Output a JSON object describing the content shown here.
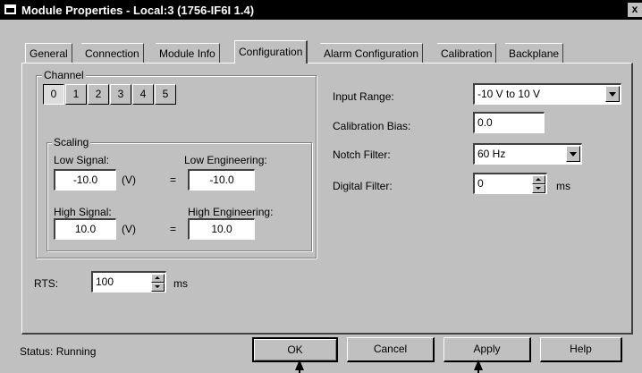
{
  "window": {
    "title": "Module Properties - Local:3 (1756-IF6I 1.4)",
    "close_glyph": "x"
  },
  "tabs": [
    {
      "label": "General"
    },
    {
      "label": "Connection"
    },
    {
      "label": "Module Info"
    },
    {
      "label": "Configuration",
      "active": true
    },
    {
      "label": "Alarm Configuration"
    },
    {
      "label": "Calibration"
    },
    {
      "label": "Backplane"
    }
  ],
  "channel": {
    "group_label": "Channel",
    "buttons": [
      "0",
      "1",
      "2",
      "3",
      "4",
      "5"
    ],
    "selected": "0"
  },
  "scaling": {
    "group_label": "Scaling",
    "low_signal_label": "Low Signal:",
    "low_signal_value": "-10.0",
    "low_engineering_label": "Low Engineering:",
    "low_engineering_value": "-10.0",
    "high_signal_label": "High Signal:",
    "high_signal_value": "10.0",
    "high_engineering_label": "High Engineering:",
    "high_engineering_value": "10.0",
    "unit": "(V)",
    "equals": "="
  },
  "settings": {
    "input_range_label": "Input Range:",
    "input_range_value": "-10 V to 10 V",
    "calibration_bias_label": "Calibration Bias:",
    "calibration_bias_value": "0.0",
    "notch_filter_label": "Notch Filter:",
    "notch_filter_value": "60 Hz",
    "digital_filter_label": "Digital Filter:",
    "digital_filter_value": "0",
    "digital_filter_unit": "ms"
  },
  "rts": {
    "label": "RTS:",
    "value": "100",
    "unit": "ms"
  },
  "status": {
    "text": "Status:  Running"
  },
  "buttons": {
    "ok": "OK",
    "cancel": "Cancel",
    "apply": "Apply",
    "help": "Help"
  }
}
